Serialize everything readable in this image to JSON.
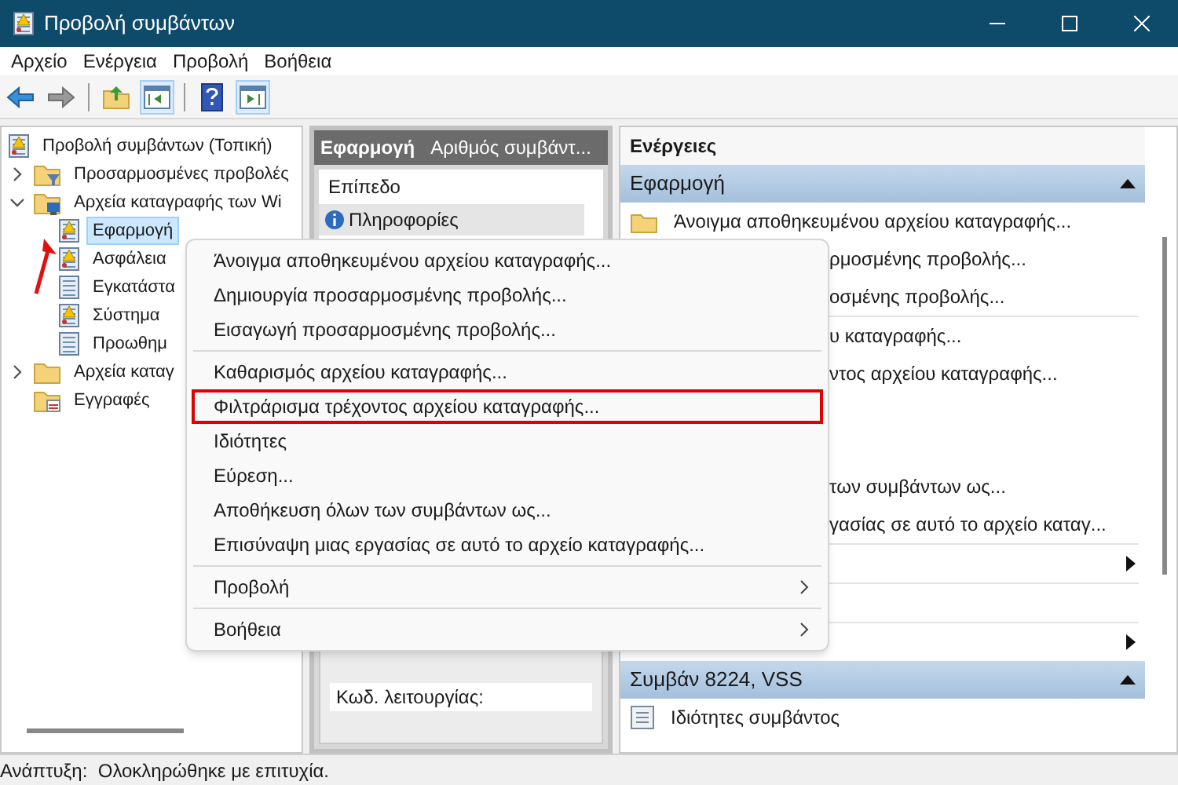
{
  "window": {
    "title": "Προβολή συμβάντων"
  },
  "menu_bar": [
    "Αρχείο",
    "Ενέργεια",
    "Προβολή",
    "Βοήθεια"
  ],
  "toolbar": [
    {
      "kind": "back",
      "pressed": false
    },
    {
      "kind": "forward",
      "pressed": false
    },
    {
      "kind": "separator"
    },
    {
      "kind": "up",
      "pressed": false
    },
    {
      "kind": "tree",
      "pressed": true
    },
    {
      "kind": "separator"
    },
    {
      "kind": "help",
      "pressed": false
    },
    {
      "kind": "pane",
      "pressed": true
    }
  ],
  "tree": {
    "label": "Προβολή συμβάντων (Τοπική)",
    "kind": "root",
    "selected": false,
    "children": [
      {
        "label": "Προσαρμοσμένες προβολές",
        "kind": "filter-folder",
        "expanded": false,
        "selected": false
      },
      {
        "label": "Αρχεία καταγραφής των Wi",
        "kind": "windows-folder",
        "expanded": true,
        "selected": false,
        "children": [
          {
            "label": "Εφαρμογή",
            "kind": "warn-log",
            "selected": true
          },
          {
            "label": "Ασφάλεια",
            "kind": "warn-log",
            "selected": false
          },
          {
            "label": "Εγκατάστα",
            "kind": "log",
            "selected": false
          },
          {
            "label": "Σύστημα",
            "kind": "warn-log",
            "selected": false
          },
          {
            "label": "Προωθημ",
            "kind": "log",
            "selected": false
          }
        ]
      },
      {
        "label": "Αρχεία καταγ",
        "kind": "folder",
        "expanded": false,
        "selected": false
      },
      {
        "label": "Εγγραφές",
        "kind": "subs-folder",
        "selected": false
      }
    ]
  },
  "events": {
    "title": "Εφαρμογή",
    "subtitle": "Αριθμός συμβάντ...",
    "column": "Επίπεδο",
    "rows": [
      {
        "text": "Πληροφορίες",
        "selected": true
      }
    ],
    "detail_label": "Κωδ. λειτουργίας:"
  },
  "actions": {
    "title": "Ενέργειες",
    "sections": [
      {
        "title": "Εφαρμογή",
        "expanded": true,
        "items": [
          {
            "kind": "item",
            "text": "Άνοιγμα αποθηκευμένου αρχείου καταγραφής..."
          },
          {
            "kind": "covered",
            "text": "ρμοσμένης προβολής..."
          },
          {
            "kind": "covered",
            "text": "οσμένης προβολής..."
          },
          {
            "kind": "separator"
          },
          {
            "kind": "covered",
            "text": "υ καταγραφής..."
          },
          {
            "kind": "covered",
            "text": "ντος αρχείου καταγραφής..."
          },
          {
            "kind": "blank"
          },
          {
            "kind": "blank"
          },
          {
            "kind": "covered",
            "text": "των συμβάντων ως..."
          },
          {
            "kind": "covered",
            "text": "γασίας σε αυτό το αρχείο καταγ..."
          },
          {
            "kind": "separator"
          },
          {
            "kind": "submenu"
          },
          {
            "kind": "separator"
          },
          {
            "kind": "blank"
          },
          {
            "kind": "separator"
          },
          {
            "kind": "submenu"
          }
        ]
      },
      {
        "title": "Συμβάν 8224, VSS",
        "expanded": true,
        "items": [
          {
            "kind": "item",
            "text": "Ιδιότητες συμβάντος"
          }
        ]
      }
    ]
  },
  "context_menu": {
    "items": [
      {
        "kind": "item",
        "text": "Άνοιγμα αποθηκευμένου αρχείου καταγραφής...",
        "highlighted": false
      },
      {
        "kind": "item",
        "text": "Δημιουργία προσαρμοσμένης προβολής...",
        "highlighted": false
      },
      {
        "kind": "item",
        "text": "Εισαγωγή προσαρμοσμένης προβολής...",
        "highlighted": false
      },
      {
        "kind": "separator"
      },
      {
        "kind": "item",
        "text": "Καθαρισμός αρχείου καταγραφής...",
        "highlighted": false
      },
      {
        "kind": "item",
        "text": "Φιλτράρισμα τρέχοντος αρχείου καταγραφής...",
        "highlighted": true
      },
      {
        "kind": "item",
        "text": "Ιδιότητες",
        "highlighted": false
      },
      {
        "kind": "item",
        "text": "Εύρεση...",
        "highlighted": false
      },
      {
        "kind": "item",
        "text": "Αποθήκευση όλων των συμβάντων ως...",
        "highlighted": false
      },
      {
        "kind": "item",
        "text": "Επισύναψη μιας εργασίας σε αυτό το αρχείο καταγραφής...",
        "highlighted": false
      },
      {
        "kind": "separator"
      },
      {
        "kind": "submenu",
        "text": "Προβολή",
        "highlighted": false
      },
      {
        "kind": "separator"
      },
      {
        "kind": "submenu",
        "text": "Βοήθεια",
        "highlighted": false
      }
    ]
  },
  "status_bar": {
    "text": "Ανάπτυξη:  Ολοκληρώθηκε με επιτυχία."
  }
}
